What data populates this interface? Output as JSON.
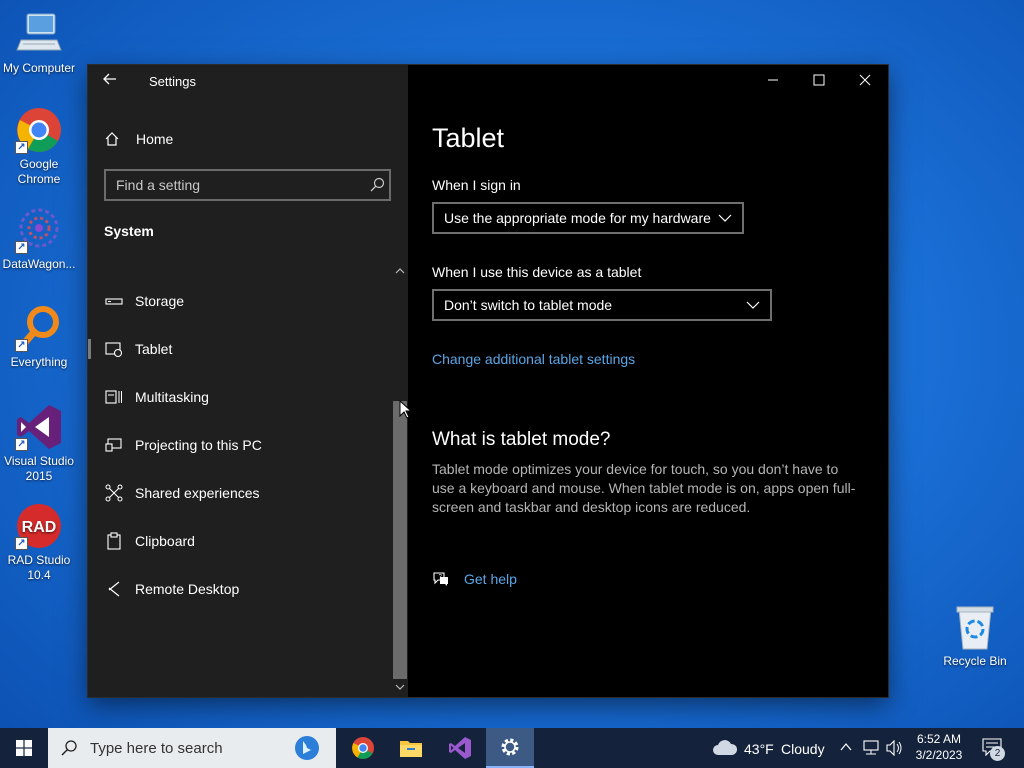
{
  "desktop": {
    "icons": [
      {
        "label": "My Computer"
      },
      {
        "label": "Google Chrome"
      },
      {
        "label": "DataWagon..."
      },
      {
        "label": "Everything"
      },
      {
        "label": "Visual Studio 2015"
      },
      {
        "label": "RAD Studio 10.4"
      },
      {
        "label": "Recycle Bin"
      }
    ],
    "rad_badge": "RAD"
  },
  "window": {
    "title": "Settings",
    "nav": {
      "home_label": "Home",
      "search_placeholder": "Find a setting",
      "section_title": "System",
      "items": [
        {
          "label": "Storage"
        },
        {
          "label": "Tablet"
        },
        {
          "label": "Multitasking"
        },
        {
          "label": "Projecting to this PC"
        },
        {
          "label": "Shared experiences"
        },
        {
          "label": "Clipboard"
        },
        {
          "label": "Remote Desktop"
        }
      ],
      "active_item": "Tablet"
    },
    "content": {
      "page_title": "Tablet",
      "sign_in_label": "When I sign in",
      "sign_in_value": "Use the appropriate mode for my hardware",
      "tablet_use_label": "When I use this device as a tablet",
      "tablet_use_value": "Don’t switch to tablet mode",
      "additional_link": "Change additional tablet settings",
      "what_is_title": "What is tablet mode?",
      "what_is_body": "Tablet mode optimizes your device for touch, so you don’t have to use a keyboard and mouse. When tablet mode is on, apps open full-screen and taskbar and desktop icons are reduced.",
      "help_link": "Get help"
    }
  },
  "taskbar": {
    "search_placeholder": "Type here to search",
    "weather_temp": "43°F",
    "weather_desc": "Cloudy",
    "time": "6:52 AM",
    "date": "3/2/2023",
    "notification_count": "2"
  },
  "colors": {
    "accent_link": "#5aa6e6",
    "nav_bg": "#1f1f1f",
    "content_bg": "#000000",
    "taskbar_bg": "#14233b"
  }
}
